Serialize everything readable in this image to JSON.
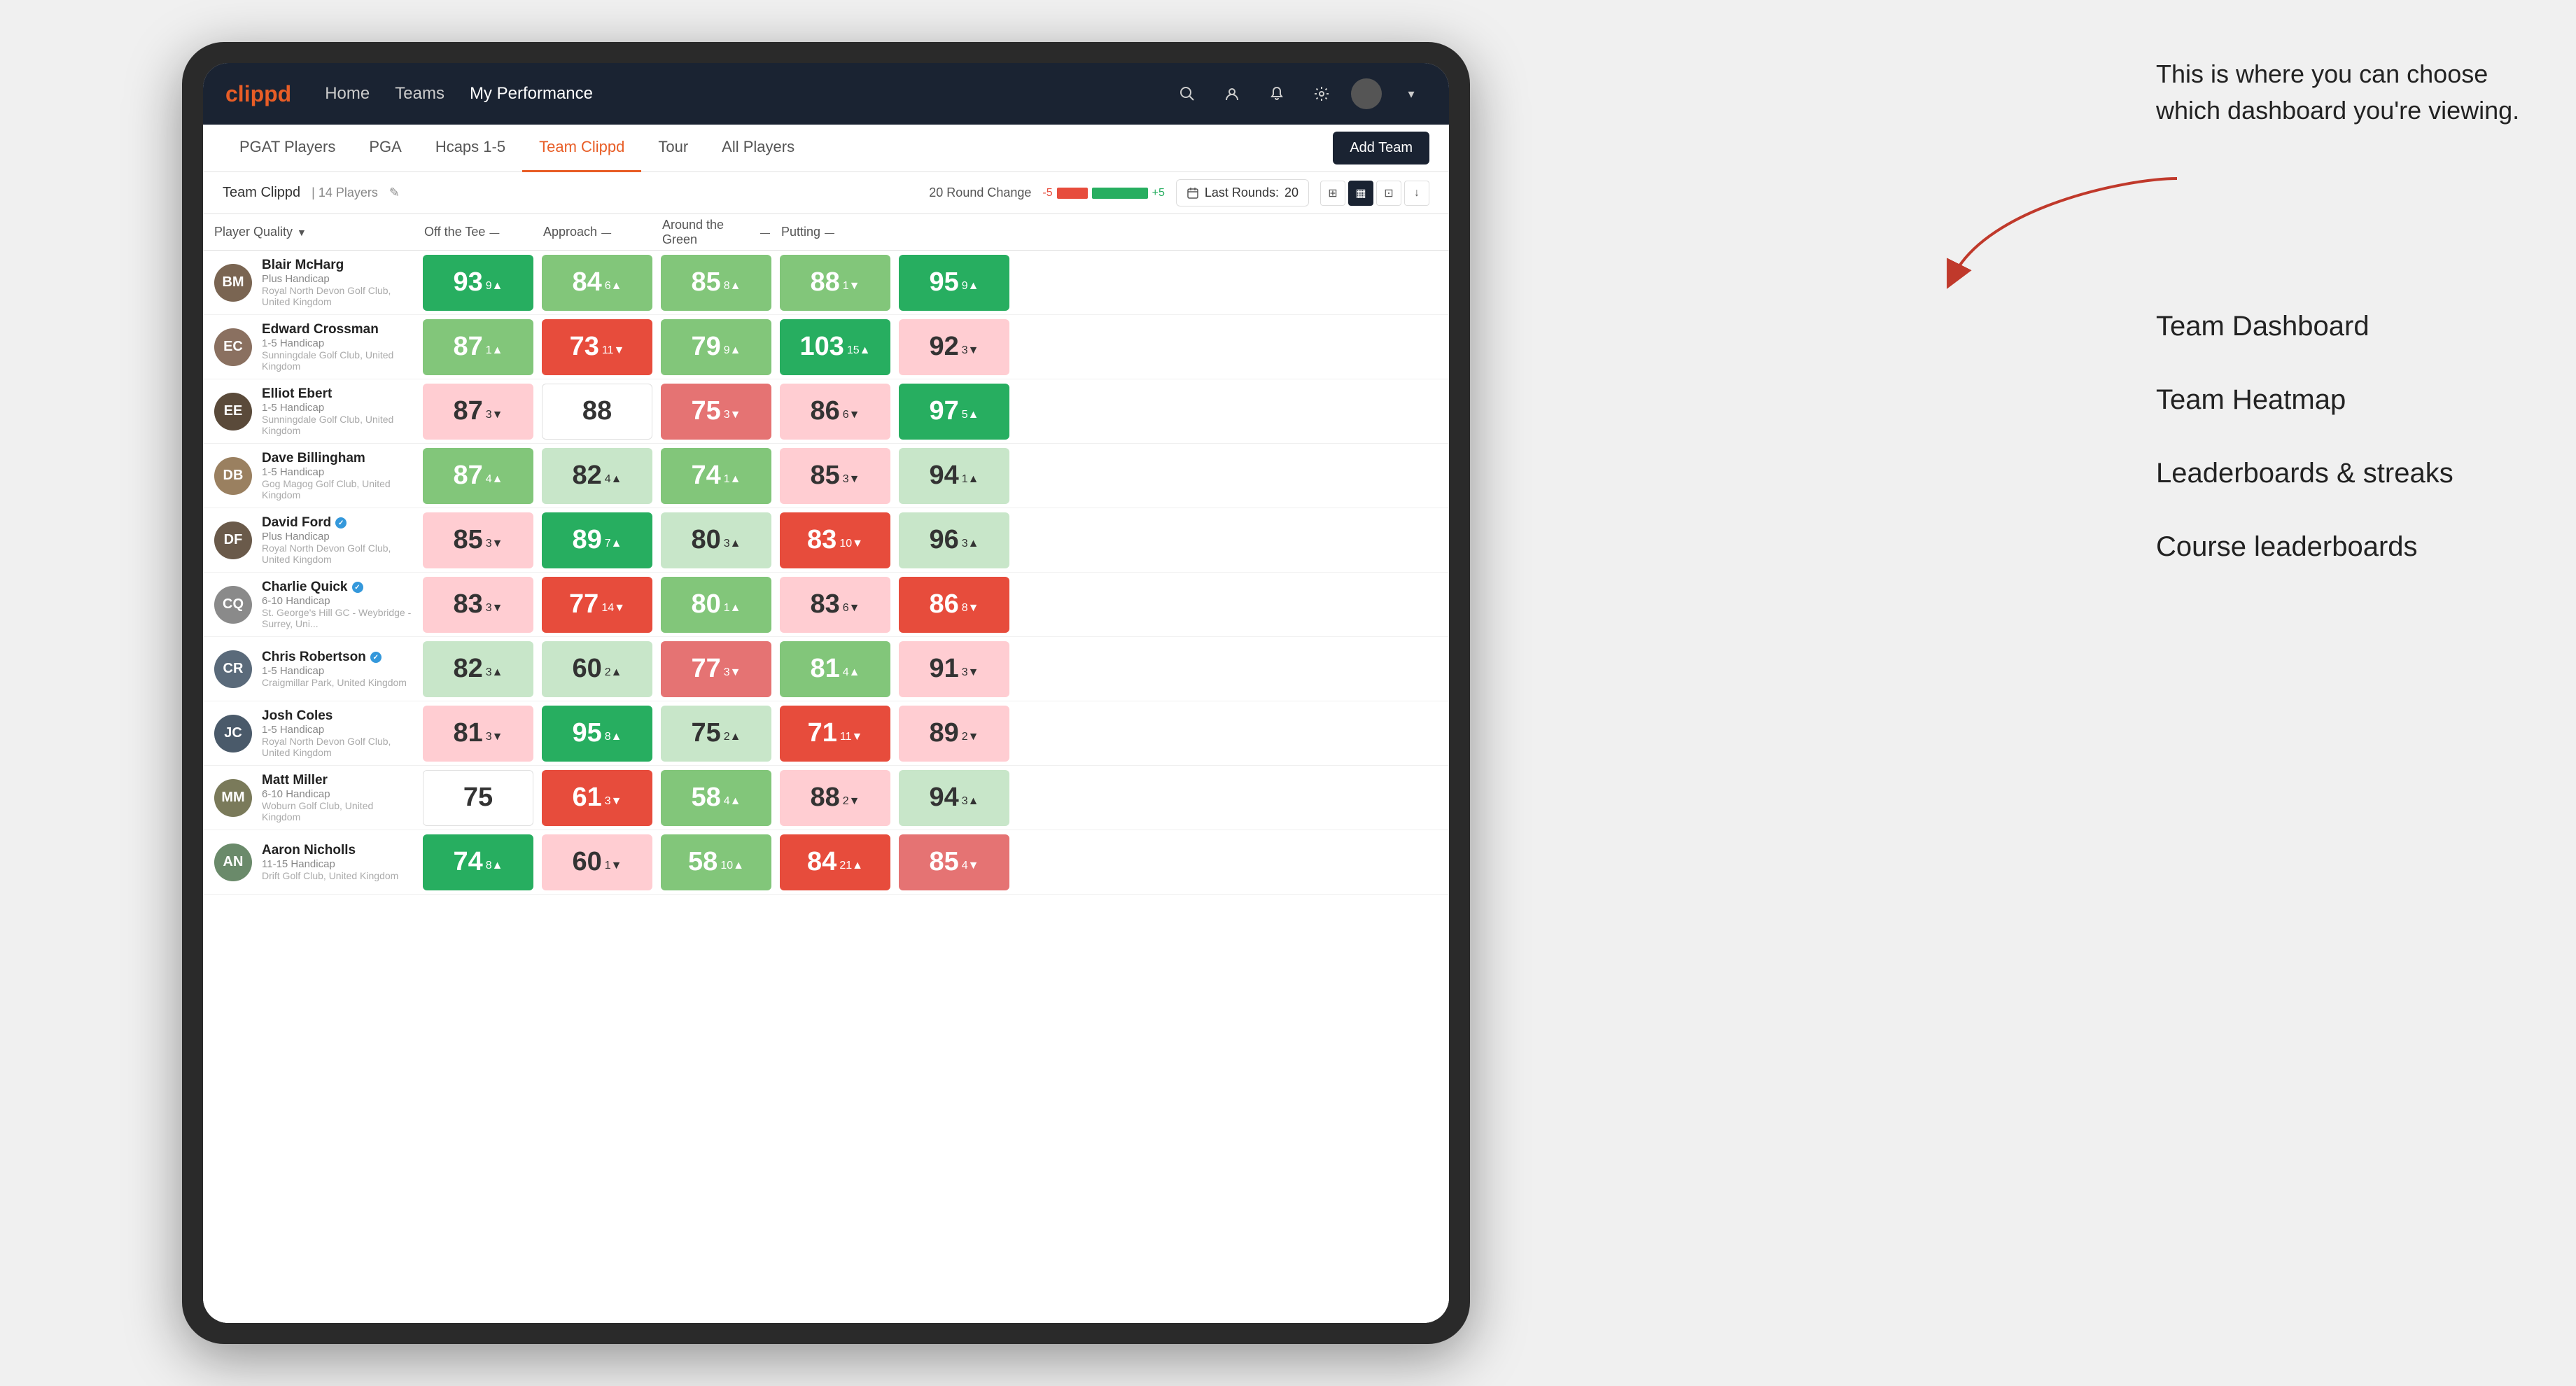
{
  "annotation": {
    "tooltip": "This is where you can choose which dashboard you're viewing.",
    "arrow_label": "arrow pointing to dashboard selector",
    "menu_options": [
      "Team Dashboard",
      "Team Heatmap",
      "Leaderboards & streaks",
      "Course leaderboards"
    ]
  },
  "nav": {
    "logo": "clippd",
    "links": [
      "Home",
      "Teams",
      "My Performance"
    ],
    "active_link": "My Performance"
  },
  "sub_tabs": {
    "tabs": [
      "PGAT Players",
      "PGA",
      "Hcaps 1-5",
      "Team Clippd",
      "Tour",
      "All Players"
    ],
    "active": "Team Clippd",
    "add_team_label": "Add Team"
  },
  "team_header": {
    "name": "Team Clippd",
    "separator": "|",
    "count": "14 Players",
    "round_change_label": "20 Round Change",
    "round_change_minus": "-5",
    "round_change_plus": "+5",
    "last_rounds_label": "Last Rounds:",
    "last_rounds_value": "20"
  },
  "col_headers": [
    {
      "label": "Player Quality",
      "arrow": "▼"
    },
    {
      "label": "Off the Tee",
      "arrow": "—"
    },
    {
      "label": "Approach",
      "arrow": "—"
    },
    {
      "label": "Around the Green",
      "arrow": "—"
    },
    {
      "label": "Putting",
      "arrow": "—"
    }
  ],
  "players": [
    {
      "name": "Blair McHarg",
      "handicap": "Plus Handicap",
      "club": "Royal North Devon Golf Club, United Kingdom",
      "avatar_color": "#7a6552",
      "initials": "BM",
      "scores": [
        {
          "value": "93",
          "change": "9",
          "dir": "up",
          "color": "dark-green"
        },
        {
          "value": "84",
          "change": "6",
          "dir": "up",
          "color": "light-green"
        },
        {
          "value": "85",
          "change": "8",
          "dir": "up",
          "color": "light-green"
        },
        {
          "value": "88",
          "change": "1",
          "dir": "down",
          "color": "light-green"
        },
        {
          "value": "95",
          "change": "9",
          "dir": "up",
          "color": "dark-green"
        }
      ]
    },
    {
      "name": "Edward Crossman",
      "handicap": "1-5 Handicap",
      "club": "Sunningdale Golf Club, United Kingdom",
      "avatar_color": "#8a7060",
      "initials": "EC",
      "scores": [
        {
          "value": "87",
          "change": "1",
          "dir": "up",
          "color": "light-green"
        },
        {
          "value": "73",
          "change": "11",
          "dir": "down",
          "color": "dark-red"
        },
        {
          "value": "79",
          "change": "9",
          "dir": "up",
          "color": "light-green"
        },
        {
          "value": "103",
          "change": "15",
          "dir": "up",
          "color": "dark-green"
        },
        {
          "value": "92",
          "change": "3",
          "dir": "down",
          "color": "pale-red"
        }
      ]
    },
    {
      "name": "Elliot Ebert",
      "handicap": "1-5 Handicap",
      "club": "Sunningdale Golf Club, United Kingdom",
      "avatar_color": "#5a4a3a",
      "initials": "EE",
      "scores": [
        {
          "value": "87",
          "change": "3",
          "dir": "down",
          "color": "pale-red"
        },
        {
          "value": "88",
          "change": "",
          "dir": "",
          "color": "white"
        },
        {
          "value": "75",
          "change": "3",
          "dir": "down",
          "color": "light-red"
        },
        {
          "value": "86",
          "change": "6",
          "dir": "down",
          "color": "pale-red"
        },
        {
          "value": "97",
          "change": "5",
          "dir": "up",
          "color": "dark-green"
        }
      ]
    },
    {
      "name": "Dave Billingham",
      "handicap": "1-5 Handicap",
      "club": "Gog Magog Golf Club, United Kingdom",
      "avatar_color": "#9a8060",
      "initials": "DB",
      "scores": [
        {
          "value": "87",
          "change": "4",
          "dir": "up",
          "color": "light-green"
        },
        {
          "value": "82",
          "change": "4",
          "dir": "up",
          "color": "pale-green"
        },
        {
          "value": "74",
          "change": "1",
          "dir": "up",
          "color": "light-green"
        },
        {
          "value": "85",
          "change": "3",
          "dir": "down",
          "color": "pale-red"
        },
        {
          "value": "94",
          "change": "1",
          "dir": "up",
          "color": "pale-green"
        }
      ]
    },
    {
      "name": "David Ford",
      "handicap": "Plus Handicap",
      "club": "Royal North Devon Golf Club, United Kingdom",
      "avatar_color": "#6a5a4a",
      "initials": "DF",
      "verified": true,
      "scores": [
        {
          "value": "85",
          "change": "3",
          "dir": "down",
          "color": "pale-red"
        },
        {
          "value": "89",
          "change": "7",
          "dir": "up",
          "color": "dark-green"
        },
        {
          "value": "80",
          "change": "3",
          "dir": "up",
          "color": "pale-green"
        },
        {
          "value": "83",
          "change": "10",
          "dir": "down",
          "color": "dark-red"
        },
        {
          "value": "96",
          "change": "3",
          "dir": "up",
          "color": "pale-green"
        }
      ]
    },
    {
      "name": "Charlie Quick",
      "handicap": "6-10 Handicap",
      "club": "St. George's Hill GC - Weybridge - Surrey, Uni...",
      "avatar_color": "#8a8a8a",
      "initials": "CQ",
      "verified": true,
      "scores": [
        {
          "value": "83",
          "change": "3",
          "dir": "down",
          "color": "pale-red"
        },
        {
          "value": "77",
          "change": "14",
          "dir": "down",
          "color": "dark-red"
        },
        {
          "value": "80",
          "change": "1",
          "dir": "up",
          "color": "light-green"
        },
        {
          "value": "83",
          "change": "6",
          "dir": "down",
          "color": "pale-red"
        },
        {
          "value": "86",
          "change": "8",
          "dir": "down",
          "color": "dark-red"
        }
      ]
    },
    {
      "name": "Chris Robertson",
      "handicap": "1-5 Handicap",
      "club": "Craigmillar Park, United Kingdom",
      "avatar_color": "#5a6a7a",
      "initials": "CR",
      "verified": true,
      "scores": [
        {
          "value": "82",
          "change": "3",
          "dir": "up",
          "color": "pale-green"
        },
        {
          "value": "60",
          "change": "2",
          "dir": "up",
          "color": "pale-green"
        },
        {
          "value": "77",
          "change": "3",
          "dir": "down",
          "color": "light-red"
        },
        {
          "value": "81",
          "change": "4",
          "dir": "up",
          "color": "light-green"
        },
        {
          "value": "91",
          "change": "3",
          "dir": "down",
          "color": "pale-red"
        }
      ]
    },
    {
      "name": "Josh Coles",
      "handicap": "1-5 Handicap",
      "club": "Royal North Devon Golf Club, United Kingdom",
      "avatar_color": "#4a5a6a",
      "initials": "JC",
      "scores": [
        {
          "value": "81",
          "change": "3",
          "dir": "down",
          "color": "pale-red"
        },
        {
          "value": "95",
          "change": "8",
          "dir": "up",
          "color": "dark-green"
        },
        {
          "value": "75",
          "change": "2",
          "dir": "up",
          "color": "pale-green"
        },
        {
          "value": "71",
          "change": "11",
          "dir": "down",
          "color": "dark-red"
        },
        {
          "value": "89",
          "change": "2",
          "dir": "down",
          "color": "pale-red"
        }
      ]
    },
    {
      "name": "Matt Miller",
      "handicap": "6-10 Handicap",
      "club": "Woburn Golf Club, United Kingdom",
      "avatar_color": "#7a7a5a",
      "initials": "MM",
      "scores": [
        {
          "value": "75",
          "change": "",
          "dir": "",
          "color": "white"
        },
        {
          "value": "61",
          "change": "3",
          "dir": "down",
          "color": "dark-red"
        },
        {
          "value": "58",
          "change": "4",
          "dir": "up",
          "color": "light-green"
        },
        {
          "value": "88",
          "change": "2",
          "dir": "down",
          "color": "pale-red"
        },
        {
          "value": "94",
          "change": "3",
          "dir": "up",
          "color": "pale-green"
        }
      ]
    },
    {
      "name": "Aaron Nicholls",
      "handicap": "11-15 Handicap",
      "club": "Drift Golf Club, United Kingdom",
      "avatar_color": "#6a8a6a",
      "initials": "AN",
      "scores": [
        {
          "value": "74",
          "change": "8",
          "dir": "up",
          "color": "dark-green"
        },
        {
          "value": "60",
          "change": "1",
          "dir": "down",
          "color": "pale-red"
        },
        {
          "value": "58",
          "change": "10",
          "dir": "up",
          "color": "light-green"
        },
        {
          "value": "84",
          "change": "21",
          "dir": "up",
          "color": "dark-red"
        },
        {
          "value": "85",
          "change": "4",
          "dir": "down",
          "color": "light-red"
        }
      ]
    }
  ]
}
